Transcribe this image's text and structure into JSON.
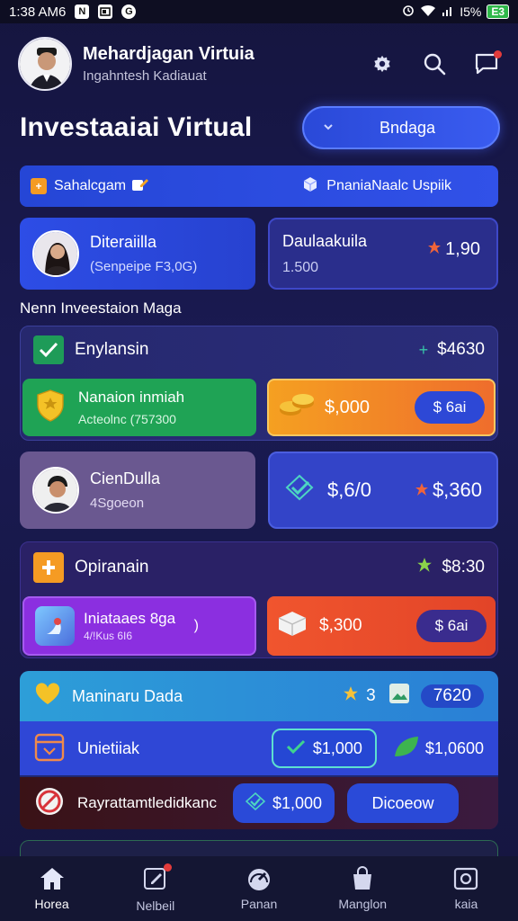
{
  "status_bar": {
    "time": "1:38 AM6",
    "glyph_a": "N",
    "glyph_b": "G",
    "right_text": "I5%",
    "battery": "E3"
  },
  "header": {
    "title": "Mehardjagan Virtuia",
    "subtitle": "Ingahntesh Kadiauat"
  },
  "page": {
    "title": "Investaaiai Virtual",
    "action_button": "Bndaga"
  },
  "banner": {
    "left_label": "Sahalcgam",
    "right_label": "PnaniaNaalc Uspiik"
  },
  "profile_card": {
    "title": "Diteraiilla",
    "subtitle": "(Senpeipe F3,0G)"
  },
  "balance_card": {
    "title": "Daulaakuila",
    "sub": "1.500",
    "value": "1,90"
  },
  "section_title": "Nenn Inveestaion Maga",
  "group1": {
    "title": "Enylansin",
    "amount": "$4630",
    "green_title": "Nanaion inmiah",
    "green_sub": "Acteolnc (757300",
    "orange_value": "$,000",
    "orange_pill": "$ 6ai"
  },
  "person2": {
    "name": "CienDulla",
    "sub": "4Sgoeon"
  },
  "value_card": {
    "left": "$,6/0",
    "right": "$,360"
  },
  "group2": {
    "title": "Opiranain",
    "amount": "$8:30",
    "purple_title": "Iniataaes 8ga",
    "purple_sub": "4/!Kus 6I6",
    "purple_mark": ")",
    "red_value": "$,300",
    "red_pill": "$ 6ai"
  },
  "group3": {
    "title": "Maninaru Dada",
    "star_value": "3",
    "amount": "7620",
    "row1_label": "Unietiiak",
    "row1_pill": "$1,000",
    "row1_value": "$1,0600",
    "row2_label": "Rayrattamtledidkanc",
    "row2_pill": "$1,000",
    "row2_button": "Dicoeow"
  },
  "nav": [
    {
      "label": "Horea"
    },
    {
      "label": "Nelbeil"
    },
    {
      "label": "Panan"
    },
    {
      "label": "Manglon"
    },
    {
      "label": "kaia"
    }
  ],
  "colors": {
    "accent": "#2d4de6",
    "green": "#1fa355",
    "orange": "#f5a021",
    "purple": "#8b2fe0",
    "red": "#f0552e"
  }
}
